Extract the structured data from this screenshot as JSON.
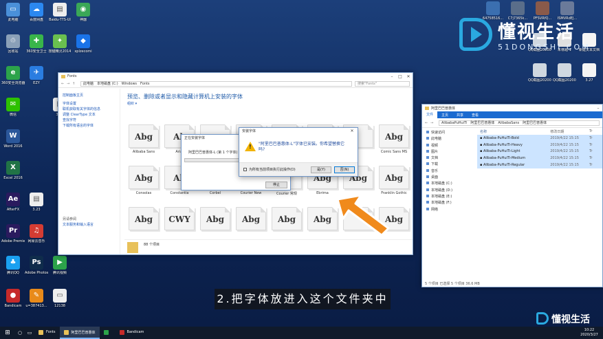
{
  "desktop_icons": [
    {
      "label": "此电脑",
      "glyph": "▭",
      "color": "#4a90d9"
    },
    {
      "label": "百度网盘",
      "glyph": "☁",
      "color": "#2b88f0"
    },
    {
      "label": "Baidu-TTS-UI",
      "glyph": "▤",
      "color": "#eeeeee"
    },
    {
      "label": "神器",
      "glyph": "◉",
      "color": "#3aa757"
    },
    {
      "label": "回收站",
      "glyph": "♲",
      "color": "#8aa0b8"
    },
    {
      "label": "360安全卫士",
      "glyph": "✚",
      "color": "#39b54a"
    },
    {
      "label": "按键精灵2014",
      "glyph": "✦",
      "color": "#6ac04f"
    },
    {
      "label": "xplzecomi",
      "glyph": "◆",
      "color": "#1a73e8"
    },
    {
      "label": "360安全浏览器",
      "glyph": "e",
      "color": "#2ca34a"
    },
    {
      "label": "EZY",
      "glyph": "✈",
      "color": "#2a7de1"
    },
    {
      "label": "微信",
      "glyph": "✉",
      "color": "#2dc100"
    },
    {
      "label": "Word 2016",
      "glyph": "W",
      "color": "#2b579a"
    },
    {
      "label": "Excel 2016",
      "glyph": "X",
      "color": "#217346"
    },
    {
      "label": "AfterFX",
      "glyph": "Ae",
      "color": "#2a1a5e"
    },
    {
      "label": "Adobe Premiere",
      "glyph": "Pr",
      "color": "#2a1a5e"
    },
    {
      "label": "网易云音乐",
      "glyph": "♫",
      "color": "#d43c33"
    },
    {
      "label": "腾讯QQ",
      "glyph": "♣",
      "color": "#1aa0f0"
    },
    {
      "label": "Adobe Photosh...",
      "glyph": "Ps",
      "color": "#0f2c4b"
    },
    {
      "label": "腾讯视频",
      "glyph": "▶",
      "color": "#2ca24a"
    },
    {
      "label": "Bandicam",
      "glyph": "●",
      "color": "#c62a2a"
    },
    {
      "label": "u=387413...",
      "glyph": "✎",
      "color": "#e88a1a"
    },
    {
      "label": "12138",
      "glyph": "▭",
      "color": "#eeeeee"
    },
    {
      "label": "3.23",
      "glyph": "▤",
      "color": "#eeeeee"
    },
    {
      "label": "3.25",
      "glyph": "▤",
      "color": "#eeeeee"
    }
  ],
  "right_icons": [
    {
      "label": "64758516...",
      "color": "#3b6fb0"
    },
    {
      "label": "C7j7365k...",
      "color": "#5a6e8a"
    },
    {
      "label": "PFSVRfQ...",
      "color": "#8a5a4a"
    },
    {
      "label": "ISMVRdEJ...",
      "color": "#6a7a9a"
    },
    {
      "label": "QQ截图20200327...",
      "color": "#d0d8e0"
    },
    {
      "label": "未标题-1",
      "color": "#e0e0e0"
    },
    {
      "label": "新建文本文档",
      "color": "#f4f4f4"
    },
    {
      "label": "QQ截图20200327...",
      "color": "#d0d8e0"
    },
    {
      "label": "QQ截图20200327...",
      "color": "#d0d8e0"
    },
    {
      "label": "3.27",
      "color": "#f4f4f4"
    }
  ],
  "logo": {
    "title": "懂视生活",
    "subtitle": "51DONGSHI.COM"
  },
  "fonts_window": {
    "title": "Fonts",
    "breadcrumb": [
      "此电脑",
      "本地磁盘 (C:)",
      "Windows",
      "Fonts"
    ],
    "search_placeholder": "搜索\"Fonts\"",
    "sidebar_links": [
      "控制面板主页",
      "字体设置",
      "联机获取有关字体的信息",
      "调整 ClearType 文本",
      "查找字符",
      "下载所有语言的字体"
    ],
    "sidebar_group": "另请参阅",
    "sidebar_bottom": [
      "文本服务和输入语言"
    ],
    "heading": "预览、删除或者显示和隐藏计算机上安装的字体",
    "organize": "组织 ▾",
    "status": "88 个项目",
    "tiles": [
      {
        "sample": "Abg",
        "name": "Alibaba Sans"
      },
      {
        "sample": "Ab",
        "name": "Arial"
      },
      {
        "sample": "",
        "name": ""
      },
      {
        "sample": "",
        "name": ""
      },
      {
        "sample": "",
        "name": ""
      },
      {
        "sample": "Abg",
        "name": ""
      },
      {
        "sample": "",
        "name": ""
      },
      {
        "sample": "Abg",
        "name": "Comic Sans MS"
      },
      {
        "sample": "Abg",
        "name": "Consolas"
      },
      {
        "sample": "Ab",
        "name": "Constantia"
      },
      {
        "sample": "",
        "name": "Corbel"
      },
      {
        "sample": "",
        "name": "Courier New"
      },
      {
        "sample": "",
        "name": "Courier 常规"
      },
      {
        "sample": "Abg",
        "name": "Ebrima"
      },
      {
        "sample": "Abg",
        "name": ""
      },
      {
        "sample": "Abg",
        "name": "Franklin Gothic"
      },
      {
        "sample": "Abg",
        "name": ""
      },
      {
        "sample": "CWY",
        "name": ""
      },
      {
        "sample": "Abg",
        "name": ""
      },
      {
        "sample": "Abg",
        "name": ""
      },
      {
        "sample": "Abg",
        "name": ""
      },
      {
        "sample": "Abg",
        "name": ""
      },
      {
        "sample": "",
        "name": ""
      },
      {
        "sample": "Abg",
        "name": ""
      }
    ]
  },
  "progress_dialog": {
    "title": "正在安装字体",
    "item": "阿里巴巴普惠体-L (第 1 个字体)",
    "stop_label": "停止"
  },
  "install_dialog": {
    "title": "安装字体",
    "message": "\"阿里巴巴普惠体-L\"字体已安装。你希望替换它吗?",
    "checkbox": "为所有当前项目执行此操作(D)",
    "yes": "是(Y)",
    "no": "否(N)"
  },
  "explorer_window": {
    "title": "阿里巴巴普惠体",
    "ribbon": [
      "文件",
      "主页",
      "共享",
      "查看"
    ],
    "path": [
      "AlibabaPuHuiTi",
      "阿里巴巴普惠体",
      "AlibabaSans",
      "阿里巴巴普惠体"
    ],
    "nav": [
      "快速访问",
      "此电脑",
      "视频",
      "图片",
      "文档",
      "下载",
      "音乐",
      "桌面",
      "本地磁盘 (C:)",
      "本地磁盘 (D:)",
      "本地磁盘 (E:)",
      "本地磁盘 (F:)",
      "网络"
    ],
    "columns": [
      "名称",
      "修改日期",
      "Tr"
    ],
    "files": [
      {
        "name": "Alibaba-PuHuiTi-Bold",
        "date": "2019/4/22 15:15",
        "type": "Tr"
      },
      {
        "name": "Alibaba-PuHuiTi-Heavy",
        "date": "2019/4/22 15:15",
        "type": "Tr"
      },
      {
        "name": "Alibaba-PuHuiTi-Light",
        "date": "2019/4/22 15:15",
        "type": "Tr"
      },
      {
        "name": "Alibaba-PuHuiTi-Medium",
        "date": "2019/4/22 15:15",
        "type": "Tr"
      },
      {
        "name": "Alibaba-PuHuiTi-Regular",
        "date": "2019/4/22 15:15",
        "type": "Tr"
      }
    ],
    "status": "5 个项目    已选择 5 个项目  36.6 MB"
  },
  "caption": "2.把字体放进入这个文件夹中",
  "taskbar": {
    "items": [
      {
        "label": "Fonts",
        "color": "#e8c15a",
        "active": false
      },
      {
        "label": "阿里巴巴普惠体",
        "color": "#e8c15a",
        "active": true
      },
      {
        "label": "",
        "color": "#2ca34a",
        "active": false
      },
      {
        "label": "Bandicam",
        "color": "#c62a2a",
        "active": false
      }
    ],
    "time": "10:22",
    "date": "2020/3/27"
  },
  "corner_logo": "懂视生活"
}
